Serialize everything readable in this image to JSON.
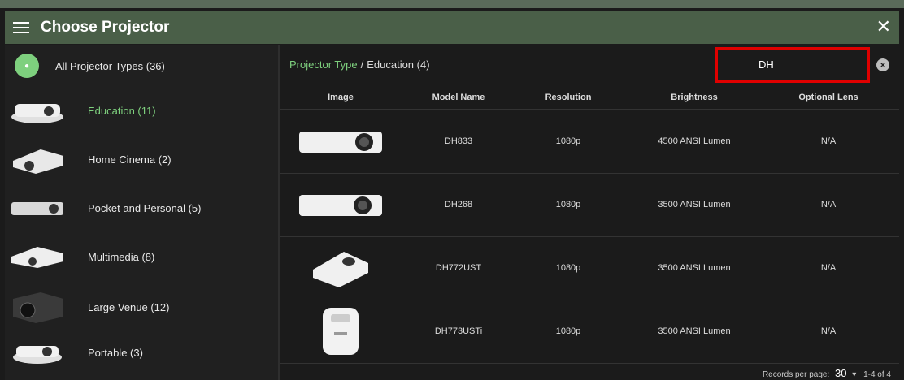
{
  "header": {
    "title": "Choose Projector"
  },
  "sidebar": {
    "all_label": "All Projector Types (36)",
    "items": [
      {
        "label": "Education (11)",
        "icon": "projector-education-icon"
      },
      {
        "label": "Home Cinema (2)",
        "icon": "projector-home-cinema-icon"
      },
      {
        "label": "Pocket and Personal (5)",
        "icon": "projector-pocket-icon"
      },
      {
        "label": "Multimedia (8)",
        "icon": "projector-multimedia-icon"
      },
      {
        "label": "Large Venue (12)",
        "icon": "projector-large-venue-icon"
      },
      {
        "label": "Portable (3)",
        "icon": "projector-portable-icon"
      }
    ]
  },
  "breadcrumb": {
    "link": "Projector Type",
    "separator": "/",
    "current": "Education (4)"
  },
  "search": {
    "value": "DH"
  },
  "table": {
    "columns": [
      "Image",
      "Model Name",
      "Resolution",
      "Brightness",
      "Optional Lens"
    ],
    "rows": [
      {
        "model": "DH833",
        "resolution": "1080p",
        "brightness": "4500 ANSI Lumen",
        "lens": "N/A"
      },
      {
        "model": "DH268",
        "resolution": "1080p",
        "brightness": "3500 ANSI Lumen",
        "lens": "N/A"
      },
      {
        "model": "DH772UST",
        "resolution": "1080p",
        "brightness": "3500 ANSI Lumen",
        "lens": "N/A"
      },
      {
        "model": "DH773USTi",
        "resolution": "1080p",
        "brightness": "3500 ANSI Lumen",
        "lens": "N/A"
      }
    ]
  },
  "footer": {
    "records_label": "Records per page:",
    "records_value": "30",
    "range": "1-4 of 4"
  },
  "colors": {
    "accent": "#7ed07e",
    "header": "#4a5f48",
    "highlight": "#e00000"
  }
}
